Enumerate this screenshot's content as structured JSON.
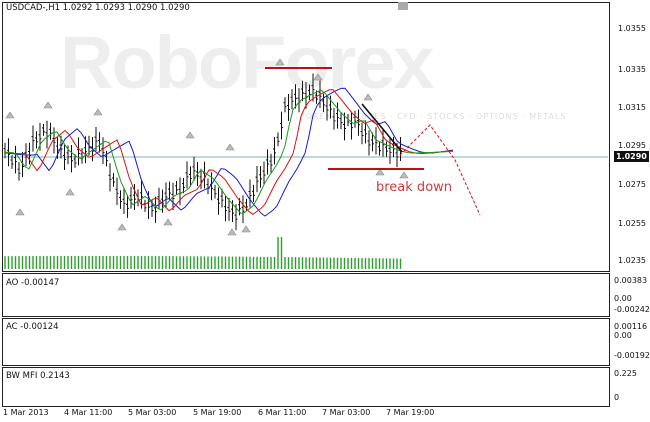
{
  "main": {
    "header": "USDCAD-,H1  1.0292 1.0293 1.0290 1.0290",
    "watermark": "RoboForex",
    "watermark_sub": "FOREX · FUTURES · CFD · STOCKS · OPTIONS · METALS",
    "annotation": "break down",
    "current_price": "1.0290",
    "price_ticks": [
      "1.0355",
      "1.0335",
      "1.0315",
      "1.0295",
      "1.0275",
      "1.0255",
      "1.0235"
    ]
  },
  "ao": {
    "label": "AO -0.00147",
    "ticks": [
      "0.00383",
      "0.00",
      "-0.00242"
    ]
  },
  "ac": {
    "label": "AC -0.00124",
    "ticks": [
      "0.00116",
      "0.00",
      "-0.00192"
    ]
  },
  "mfi": {
    "label": "BW MFI 0.2143",
    "ticks": [
      "0.225",
      "0"
    ]
  },
  "time_axis": [
    "1 Mar 2013",
    "4 Mar 11:00",
    "5 Mar 03:00",
    "5 Mar 19:00",
    "6 Mar 11:00",
    "7 Mar 03:00",
    "7 Mar 19:00"
  ],
  "colors": {
    "up": "#2aa02a",
    "down": "#d2691e",
    "red": "#e01010",
    "blue": "#1a1acd",
    "green": "#1a9a1a",
    "resistance": "#b5121b"
  }
}
